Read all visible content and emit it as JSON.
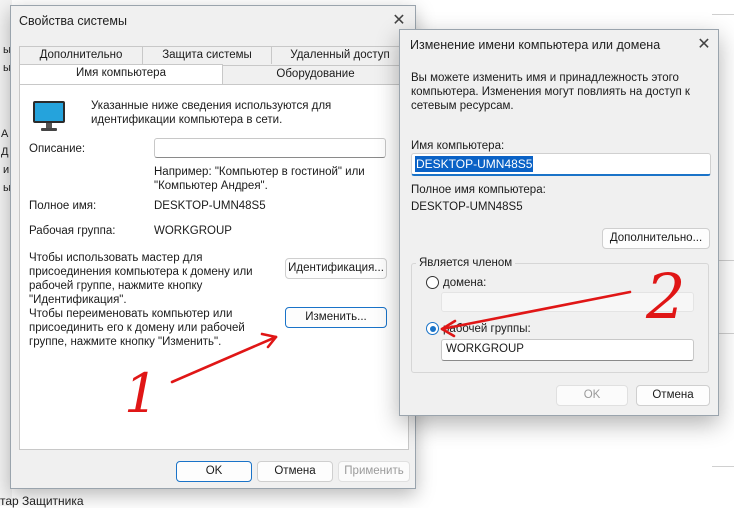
{
  "background": {
    "left_fragments": [
      "А",
      "ы",
      "Д",
      "ы",
      "и",
      "ы"
    ],
    "bottom_text": "тар Защитника"
  },
  "system_dialog": {
    "title": "Свойства системы",
    "tabs_row1": [
      "Дополнительно",
      "Защита системы",
      "Удаленный доступ"
    ],
    "tabs_row2": [
      "Имя компьютера",
      "Оборудование"
    ],
    "intro": "Указанные ниже сведения используются для идентификации компьютера в сети.",
    "description_label": "Описание:",
    "description_value": "",
    "example": "Например: \"Компьютер в гостиной\" или \"Компьютер Андрея\".",
    "fullname_label": "Полное имя:",
    "fullname_value": "DESKTOP-UMN48S5",
    "workgroup_label": "Рабочая группа:",
    "workgroup_value": "WORKGROUP",
    "wizard_text": "Чтобы использовать мастер для присоединения компьютера к домену или рабочей группе, нажмите кнопку \"Идентификация\".",
    "identification_button": "Идентификация...",
    "rename_text": "Чтобы переименовать компьютер или присоединить его к домену или рабочей группе, нажмите кнопку \"Изменить\".",
    "change_button": "Изменить...",
    "ok_button": "OK",
    "cancel_button": "Отмена",
    "apply_button": "Применить"
  },
  "rename_dialog": {
    "title": "Изменение имени компьютера или домена",
    "intro": "Вы можете изменить имя и принадлежность этого компьютера. Изменения могут повлиять на доступ к сетевым ресурсам.",
    "computer_name_label": "Имя компьютера:",
    "computer_name_value": "DESKTOP-UMN48S5",
    "fullname_label": "Полное имя компьютера:",
    "fullname_value": "DESKTOP-UMN48S5",
    "more_button": "Дополнительно...",
    "member_of_legend": "Является членом",
    "domain_label": "домена:",
    "domain_value": "",
    "workgroup_label": "рабочей группы:",
    "workgroup_value": "WORKGROUP",
    "ok_button": "OK",
    "cancel_button": "Отмена"
  },
  "annotations": {
    "label_1": "1",
    "label_2": "2",
    "color": "#e01616"
  },
  "colors": {
    "accent": "#1a73c8",
    "selection": "#0a62c6",
    "dialog_bg": "#f0f0f0"
  }
}
